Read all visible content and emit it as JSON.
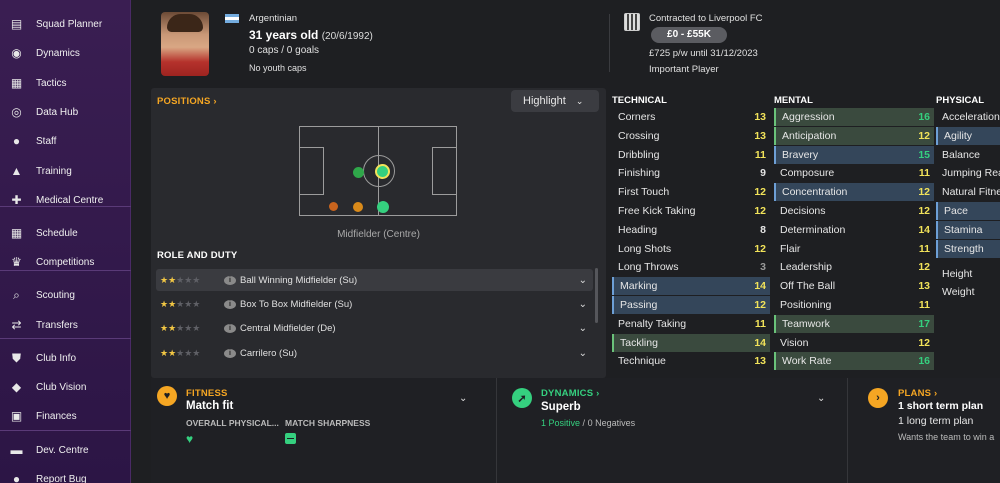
{
  "sidebar": {
    "items": [
      {
        "label": "Squad Planner",
        "icon": "clipboard-icon",
        "glyph": "▤"
      },
      {
        "label": "Dynamics",
        "icon": "dynamics-icon",
        "glyph": "◉"
      },
      {
        "label": "Tactics",
        "icon": "tactics-board-icon",
        "glyph": "▦"
      },
      {
        "label": "Data Hub",
        "icon": "data-hub-icon",
        "glyph": "◎"
      },
      {
        "label": "Staff",
        "icon": "staff-icon",
        "glyph": "●"
      },
      {
        "label": "Training",
        "icon": "training-icon",
        "glyph": "▲"
      },
      {
        "label": "Medical Centre",
        "icon": "medical-icon",
        "glyph": "✚"
      },
      {
        "label": "Schedule",
        "icon": "calendar-icon",
        "glyph": "▦"
      },
      {
        "label": "Competitions",
        "icon": "trophy-icon",
        "glyph": "♛"
      },
      {
        "label": "Scouting",
        "icon": "search-icon",
        "glyph": "⌕"
      },
      {
        "label": "Transfers",
        "icon": "transfers-icon",
        "glyph": "⇄"
      },
      {
        "label": "Club Info",
        "icon": "shield-icon",
        "glyph": "⛊"
      },
      {
        "label": "Club Vision",
        "icon": "vision-icon",
        "glyph": "◆"
      },
      {
        "label": "Finances",
        "icon": "finances-icon",
        "glyph": "▣"
      },
      {
        "label": "Dev. Centre",
        "icon": "dev-centre-icon",
        "glyph": "▬"
      },
      {
        "label": "Report Bug",
        "icon": "bug-icon",
        "glyph": "●"
      }
    ]
  },
  "header": {
    "nationality": "Argentinian",
    "age": "31 years old",
    "dob": "(20/6/1992)",
    "caps": "0 caps / 0 goals",
    "youth_caps": "No youth caps",
    "contract": "Contracted to Liverpool FC",
    "value": "£0 - £55K",
    "wage": "£725 p/w until 31/12/2023",
    "squad_status": "Important Player"
  },
  "positions": {
    "title": "POSITIONS",
    "highlight_label": "Highlight",
    "position_label": "Midfielder (Centre)",
    "role_title": "ROLE AND DUTY",
    "roles": [
      {
        "stars": "★★",
        "empty": "★★★",
        "name": "Ball Winning Midfielder (Su)"
      },
      {
        "stars": "★★",
        "empty": "★★★",
        "name": "Box To Box Midfielder (Su)"
      },
      {
        "stars": "★★",
        "empty": "★★★",
        "name": "Central Midfielder (De)"
      },
      {
        "stars": "★★",
        "empty": "★★★",
        "name": "Carrilero (Su)"
      }
    ]
  },
  "technical": {
    "title": "TECHNICAL",
    "rows": [
      {
        "name": "Corners",
        "value": "13"
      },
      {
        "name": "Crossing",
        "value": "13"
      },
      {
        "name": "Dribbling",
        "value": "11"
      },
      {
        "name": "Finishing",
        "value": "9"
      },
      {
        "name": "First Touch",
        "value": "12"
      },
      {
        "name": "Free Kick Taking",
        "value": "12"
      },
      {
        "name": "Heading",
        "value": "8"
      },
      {
        "name": "Long Shots",
        "value": "12"
      },
      {
        "name": "Long Throws",
        "value": "3"
      },
      {
        "name": "Marking",
        "value": "14"
      },
      {
        "name": "Passing",
        "value": "12"
      },
      {
        "name": "Penalty Taking",
        "value": "11"
      },
      {
        "name": "Tackling",
        "value": "14"
      },
      {
        "name": "Technique",
        "value": "13"
      }
    ]
  },
  "mental": {
    "title": "MENTAL",
    "rows": [
      {
        "name": "Aggression",
        "value": "16"
      },
      {
        "name": "Anticipation",
        "value": "12"
      },
      {
        "name": "Bravery",
        "value": "15"
      },
      {
        "name": "Composure",
        "value": "11"
      },
      {
        "name": "Concentration",
        "value": "12"
      },
      {
        "name": "Decisions",
        "value": "12"
      },
      {
        "name": "Determination",
        "value": "14"
      },
      {
        "name": "Flair",
        "value": "11"
      },
      {
        "name": "Leadership",
        "value": "12"
      },
      {
        "name": "Off The Ball",
        "value": "13"
      },
      {
        "name": "Positioning",
        "value": "11"
      },
      {
        "name": "Teamwork",
        "value": "17"
      },
      {
        "name": "Vision",
        "value": "12"
      },
      {
        "name": "Work Rate",
        "value": "16"
      }
    ]
  },
  "physical": {
    "title": "PHYSICAL",
    "rows": [
      {
        "name": "Acceleration"
      },
      {
        "name": "Agility"
      },
      {
        "name": "Balance"
      },
      {
        "name": "Jumping Reach"
      },
      {
        "name": "Natural Fitness"
      },
      {
        "name": "Pace"
      },
      {
        "name": "Stamina"
      },
      {
        "name": "Strength"
      }
    ],
    "height_label": "Height",
    "weight_label": "Weight"
  },
  "fitness": {
    "title": "FITNESS",
    "value": "Match fit",
    "overall_label": "OVERALL PHYSICAL...",
    "sharpness_label": "MATCH SHARPNESS"
  },
  "dynamics": {
    "title": "DYNAMICS",
    "value": "Superb",
    "positives": "1 Positive",
    "separator": "/",
    "negatives": "0 Negatives"
  },
  "plans": {
    "title": "PLANS",
    "short_term": "1 short term plan",
    "long_term": "1 long term plan",
    "note": "Wants the team to win a"
  },
  "colors": {
    "accent": "#f5a623",
    "green": "#35d07f",
    "value_yellow": "#f2e35a",
    "sidebar": "#3a1e52"
  }
}
